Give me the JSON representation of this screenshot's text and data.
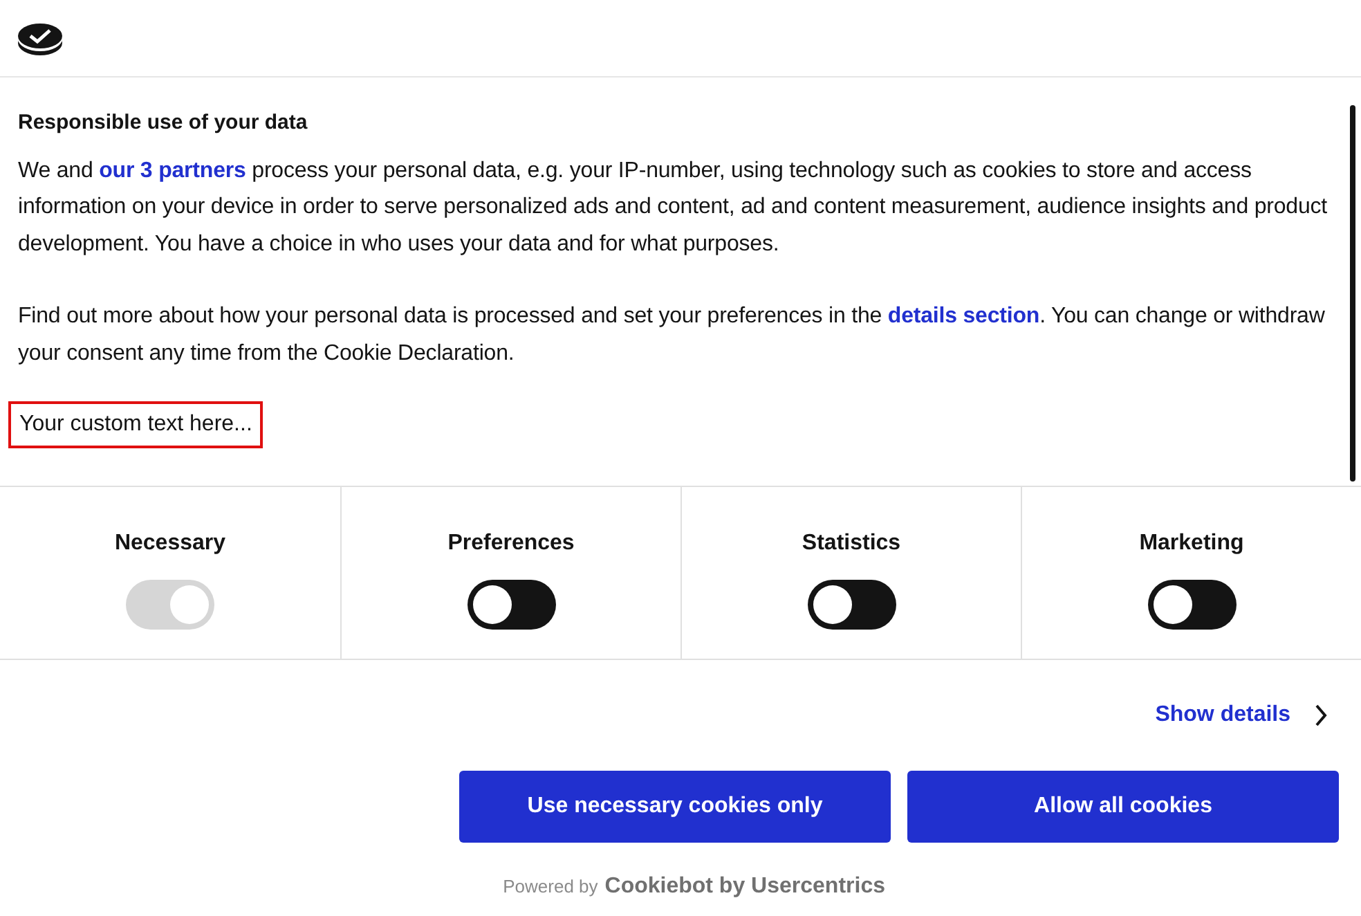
{
  "title": "Responsible use of your data",
  "paragraphs": [
    {
      "before": "We and ",
      "link": "our 3 partners",
      "after": " process your personal data, e.g. your IP-number, using technology such as cookies to store and access information on your device in order to serve personalized ads and content, ad and content measurement, audience insights and product development. You have a choice in who uses your data and for what purposes."
    },
    {
      "before": "Find out more about how your personal data is processed and set your preferences in the ",
      "link": "details section",
      "after": ". You can change or withdraw your consent any time from the Cookie Declaration."
    }
  ],
  "custom_text": "Your custom text here...",
  "categories": [
    {
      "label": "Necessary",
      "checked": true,
      "disabled": true
    },
    {
      "label": "Preferences",
      "checked": false,
      "disabled": false
    },
    {
      "label": "Statistics",
      "checked": false,
      "disabled": false
    },
    {
      "label": "Marketing",
      "checked": false,
      "disabled": false
    }
  ],
  "show_details": "Show details",
  "buttons": [
    "Use necessary cookies only",
    "Allow all cookies"
  ],
  "powered_by": {
    "prefix": "Powered by",
    "brand": "Cookiebot by Usercentrics"
  }
}
